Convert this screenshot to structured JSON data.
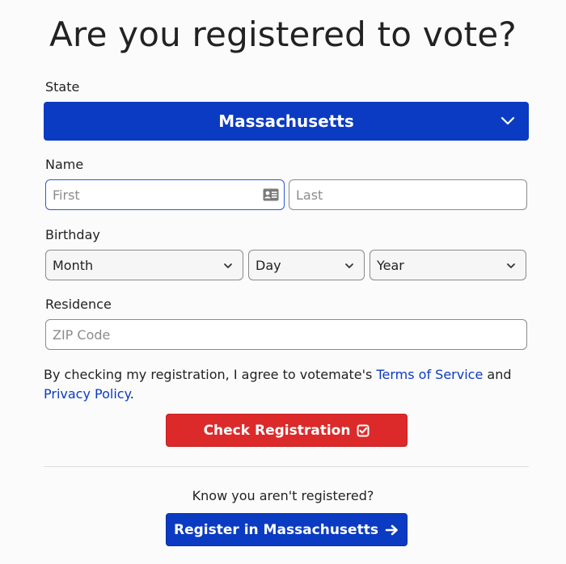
{
  "page": {
    "title": "Are you registered to vote?"
  },
  "state": {
    "label": "State",
    "selected": "Massachusetts"
  },
  "name": {
    "label": "Name",
    "first_placeholder": "First",
    "last_placeholder": "Last",
    "first_value": "",
    "last_value": ""
  },
  "birthday": {
    "label": "Birthday",
    "month": "Month",
    "day": "Day",
    "year": "Year"
  },
  "residence": {
    "label": "Residence",
    "zip_placeholder": "ZIP Code"
  },
  "agreement": {
    "prefix": "By checking my registration, I agree to votemate's ",
    "terms_link": "Terms of Service",
    "middle": " and ",
    "privacy_link": "Privacy Policy",
    "suffix": "."
  },
  "actions": {
    "check_label": "Check Registration",
    "know_text": "Know you aren't registered?",
    "register_label": "Register in Massachusetts"
  },
  "colors": {
    "primary": "#0a3bc2",
    "danger": "#dc2a2a",
    "link": "#0a3bc2"
  },
  "icons": {
    "state_chevron": "chevron-down-icon",
    "contact_card": "contact-card-icon",
    "check": "check-square-icon",
    "arrow": "arrow-right-icon"
  }
}
